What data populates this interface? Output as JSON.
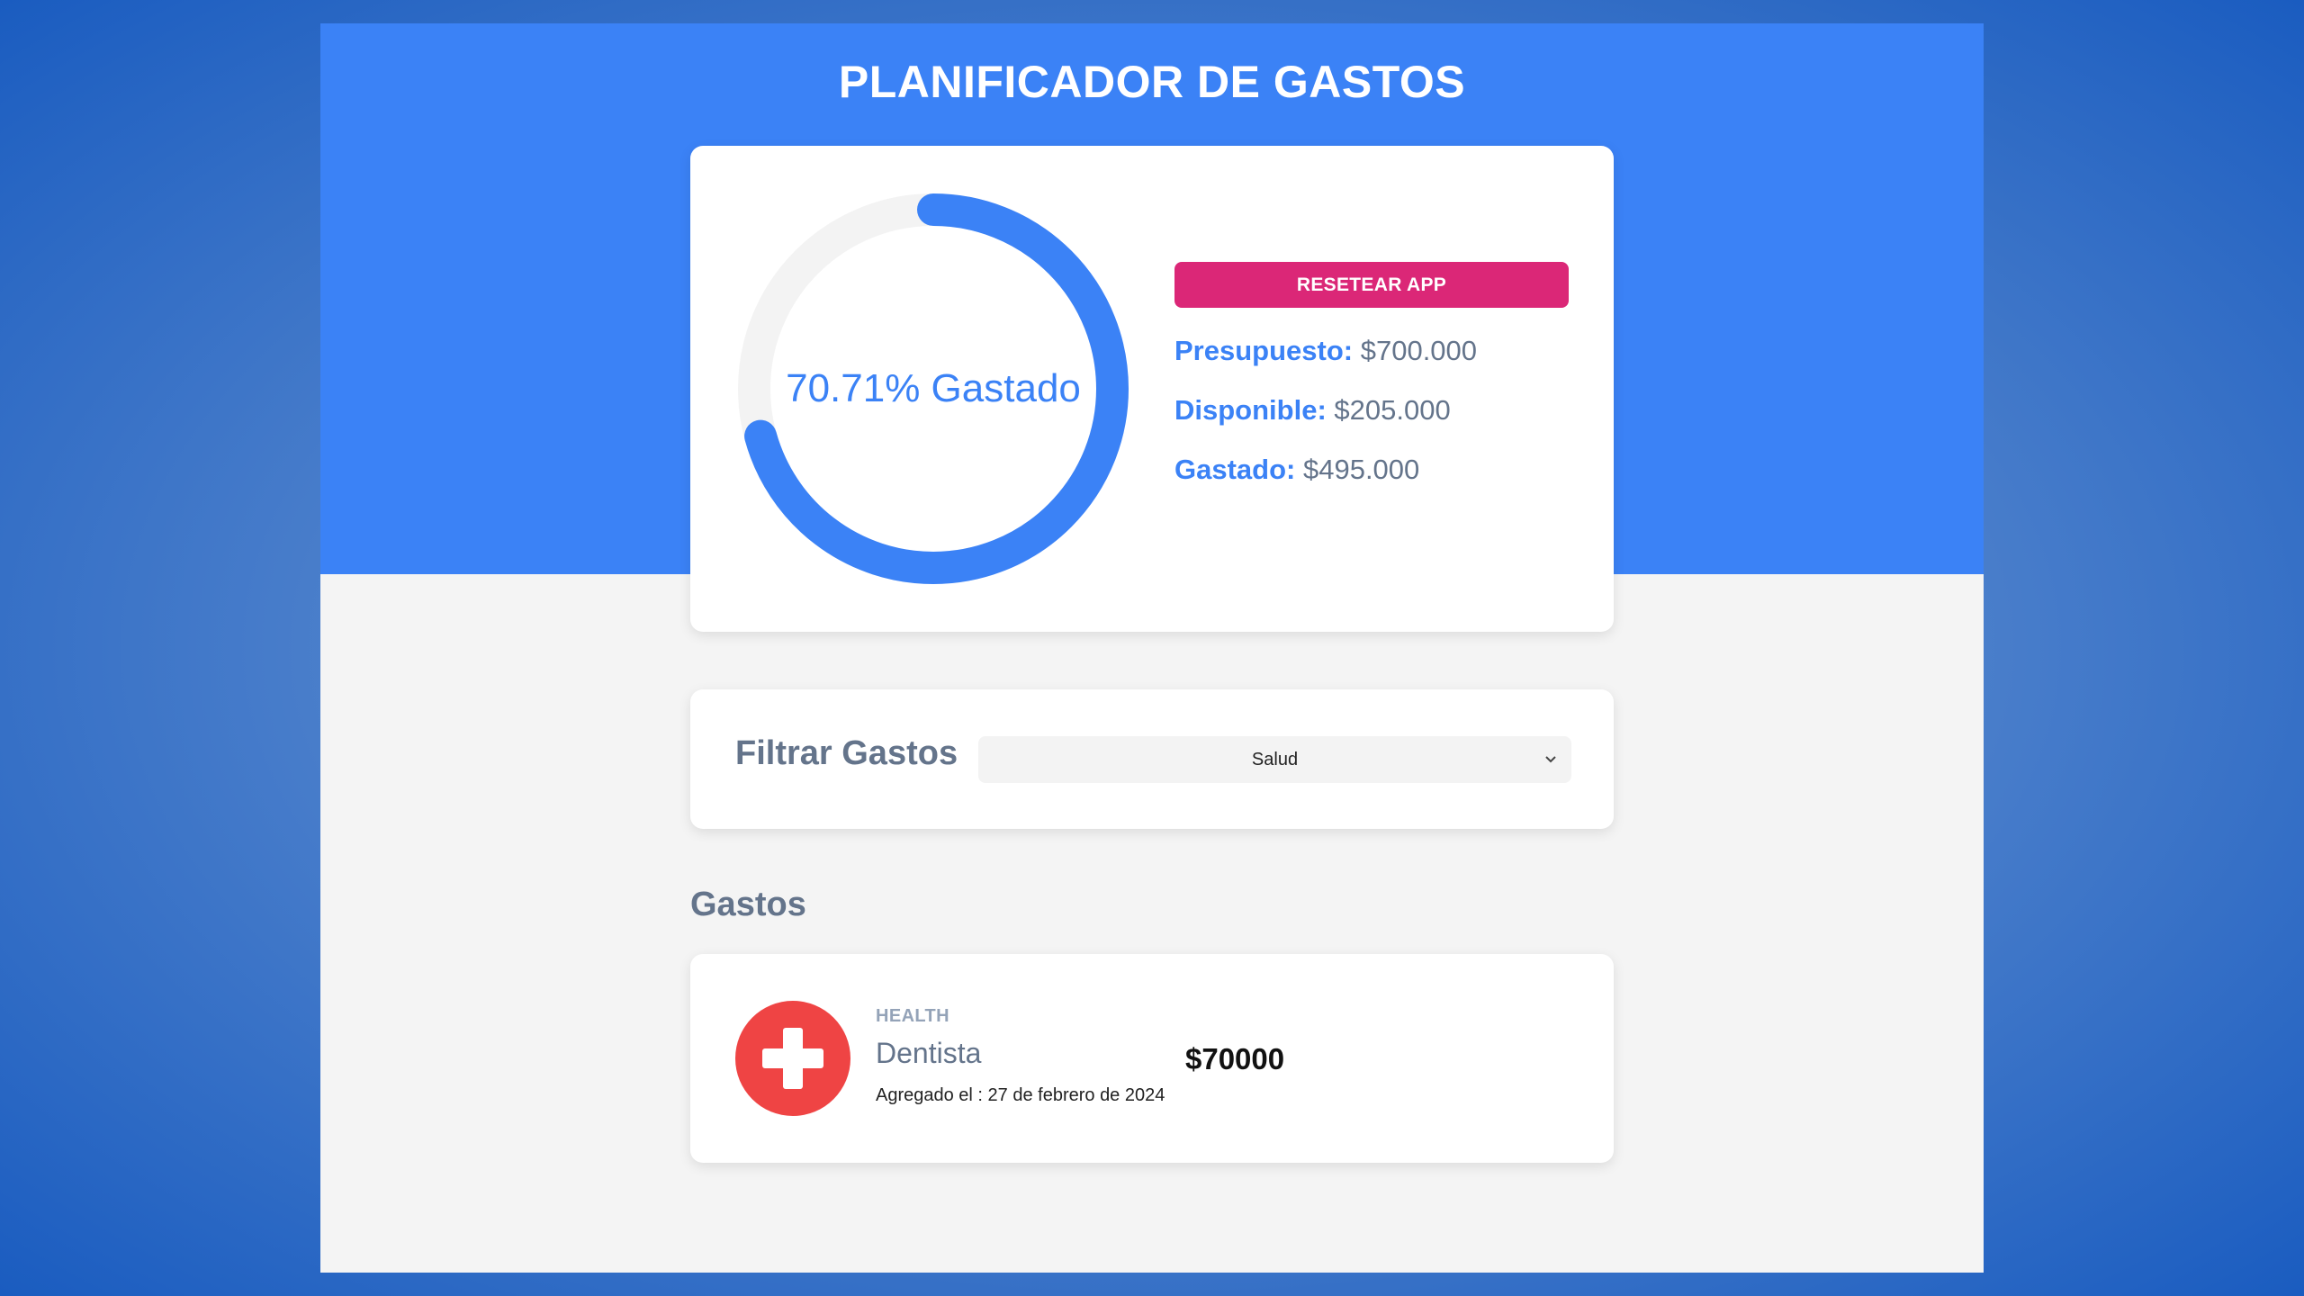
{
  "header": {
    "title": "PLANIFICADOR DE GASTOS"
  },
  "budget": {
    "spent_percent": 70.71,
    "ring_label": "70.71% Gastado",
    "reset_label": "RESETEAR APP",
    "stats": [
      {
        "label": "Presupuesto:",
        "value": "$700.000"
      },
      {
        "label": "Disponible:",
        "value": "$205.000"
      },
      {
        "label": "Gastado:",
        "value": "$495.000"
      }
    ]
  },
  "filter": {
    "label": "Filtrar Gastos",
    "selected": "Salud"
  },
  "expenses": {
    "heading": "Gastos",
    "items": [
      {
        "category": "HEALTH",
        "name": "Dentista",
        "date": "Agregado el : 27 de febrero de 2024",
        "amount": "$70000",
        "icon": "health-cross-icon"
      }
    ]
  },
  "colors": {
    "primary": "#3b82f6",
    "reset": "#db2777",
    "health": "#ef4444",
    "track": "#f3f3f3"
  }
}
